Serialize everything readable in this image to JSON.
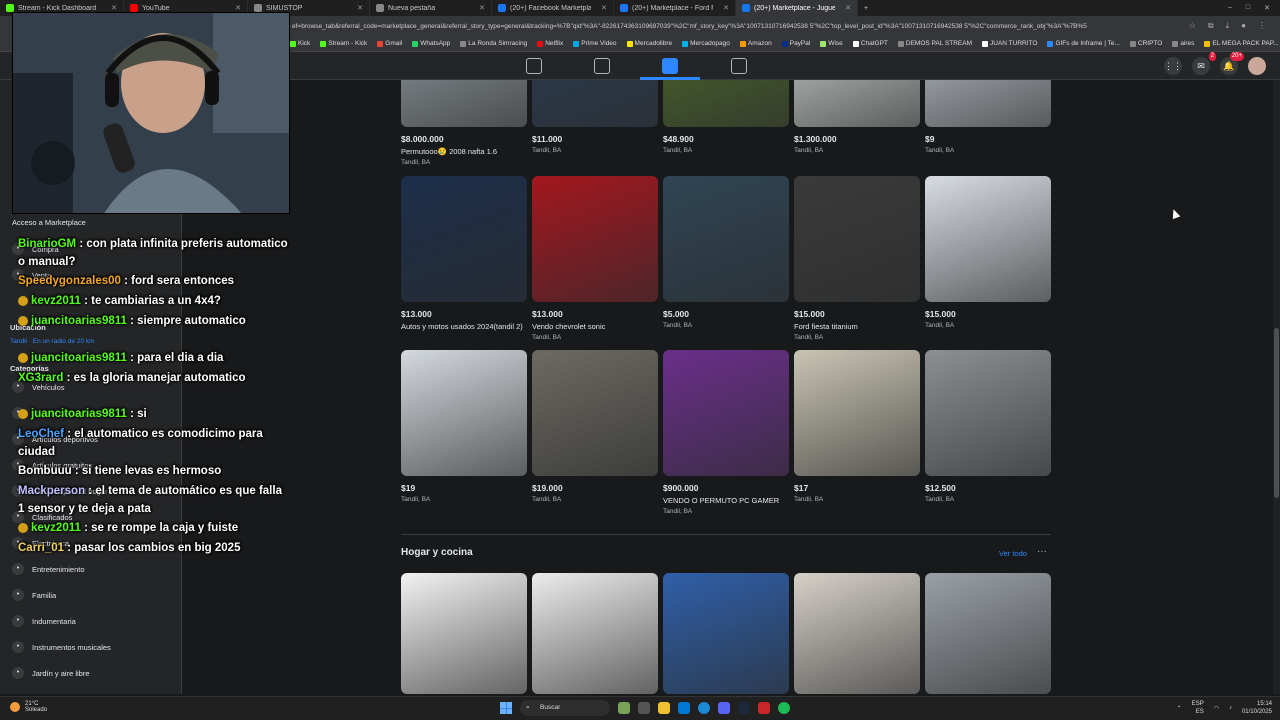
{
  "browser": {
    "tabs": [
      {
        "label": "Stream - Kick Dashboard",
        "color": "#53fc18"
      },
      {
        "label": "YouTube",
        "color": "#ff0000"
      },
      {
        "label": "SIMUSTOP",
        "color": "#888888"
      },
      {
        "label": "Nueva pestaña",
        "color": "#888888"
      },
      {
        "label": "(20+) Facebook Marketplace | Fa...",
        "color": "#1877f2"
      },
      {
        "label": "(20+) Marketplace - Ford Focus",
        "color": "#1877f2"
      },
      {
        "label": "(20+) Marketplace - Juguetes tu...",
        "color": "#1877f2"
      }
    ],
    "url": "ef=browse_tab&referral_code=marketplace_general&referral_story_type=general&tracking=%7B\"qid\"%3A\"-8226174363109697039\"%2C\"mf_story_key\"%3A\"10071310716942538 5\"%2C\"top_level_post_id\"%3A\"10071310716942538 5\"%2C\"commerce_rank_obj\"%3A\"%7B%5",
    "bookmarks": [
      {
        "label": "Kick",
        "color": "#53fc18"
      },
      {
        "label": "Stream - Kick",
        "color": "#53fc18"
      },
      {
        "label": "Gmail",
        "color": "#ea4335"
      },
      {
        "label": "WhatsApp",
        "color": "#25d366"
      },
      {
        "label": "La Ronda Simracing",
        "color": "#888888"
      },
      {
        "label": "Netflix",
        "color": "#e50914"
      },
      {
        "label": "Prime Video",
        "color": "#00a8e1"
      },
      {
        "label": "Mercadolibre",
        "color": "#ffe600"
      },
      {
        "label": "Mercadopago",
        "color": "#00b1ea"
      },
      {
        "label": "Amazon",
        "color": "#ff9900"
      },
      {
        "label": "PayPal",
        "color": "#003087"
      },
      {
        "label": "Wise",
        "color": "#9fe870"
      },
      {
        "label": "ChatGPT",
        "color": "#ffffff"
      },
      {
        "label": "DEMOS PAL STREAM",
        "color": "#888888"
      },
      {
        "label": "JUAN TURRITO",
        "color": "#ffffff"
      },
      {
        "label": "GIFs de Inframe | Te...",
        "color": "#2d88ff"
      },
      {
        "label": "CRIPTO",
        "color": "#888888"
      },
      {
        "label": "aires",
        "color": "#888888"
      },
      {
        "label": "EL MEGA PACK PAP...",
        "color": "#f0c000"
      }
    ]
  },
  "fb_header": {
    "badges": {
      "messenger": "2",
      "notifications": "20+"
    }
  },
  "sidebar": {
    "top_link": "Acceso a Marketplace",
    "items_top": [
      {
        "label": "Compra",
        "icon": "shop-icon"
      },
      {
        "label": "Venta",
        "icon": "tag-icon"
      }
    ],
    "location_heading": "Ubicación",
    "location_value": "Tandil · En un radio de 20 km",
    "categories_heading": "Categorías",
    "categories": [
      {
        "label": "Vehículos",
        "icon": "car-icon"
      },
      {
        "label": "Alquiler de propiedades",
        "icon": "house-icon"
      },
      {
        "label": "Artículos deportivos",
        "icon": "sport-icon"
      },
      {
        "label": "Artículos gratuitos",
        "icon": "gift-icon"
      },
      {
        "label": "Artículos para el hogar",
        "icon": "home-icon"
      },
      {
        "label": "Clasificados",
        "icon": "list-icon"
      },
      {
        "label": "Electrónica",
        "icon": "phone-icon"
      },
      {
        "label": "Entretenimiento",
        "icon": "people-icon"
      },
      {
        "label": "Familia",
        "icon": "heart-icon"
      },
      {
        "label": "Indumentaria",
        "icon": "shirt-icon"
      },
      {
        "label": "Instrumentos musicales",
        "icon": "music-icon"
      },
      {
        "label": "Jardín y aire libre",
        "icon": "garden-icon"
      }
    ]
  },
  "chat": [
    {
      "user": "BinarioGM",
      "color": "#53fc18",
      "text": "con plata infinita preferis automatico o manual?",
      "badge": false
    },
    {
      "user": "Speedygonzales00",
      "color": "#f5a623",
      "text": "ford sera entonces",
      "badge": false
    },
    {
      "user": "kevz2011",
      "color": "#53fc18",
      "text": "te cambiarias a un 4x4?",
      "badge": true
    },
    {
      "user": "juancitoarias9811",
      "color": "#53fc18",
      "text": "siempre automatico",
      "badge": true
    },
    {
      "user": "juancitoarias9811",
      "color": "#53fc18",
      "text": "para el dia a dia",
      "badge": true
    },
    {
      "user": "XG3rard",
      "color": "#53fc18",
      "text": "es la gloria manejar automatico",
      "badge": false
    },
    {
      "user": "juancitoarias9811",
      "color": "#53fc18",
      "text": "si",
      "badge": true
    },
    {
      "user": "LeoChef",
      "color": "#4aa3ff",
      "text": "el automatico es comodicimo para ciudad",
      "badge": false
    },
    {
      "user": "Bombuuu",
      "color": "#ffffff",
      "text": "si tiene levas es hermoso",
      "badge": false
    },
    {
      "user": "Mackperson",
      "color": "#c0c0ff",
      "text": "el tema de automático es que falla 1 sensor y te deja a pata",
      "badge": false
    },
    {
      "user": "kevz2011",
      "color": "#53fc18",
      "text": "se re rompe la caja y fuiste",
      "badge": true
    },
    {
      "user": "Carri_01",
      "color": "#f0d060",
      "text": "pasar los cambios en big 2025",
      "badge": false
    }
  ],
  "listings_row1": [
    {
      "price": "$8.000.000",
      "title": "Permutooo😢 2008 nafta 1.6",
      "loc": "Tandil, BA",
      "bg": "#9aa3a8"
    },
    {
      "price": "$11.000",
      "title": "",
      "loc": "Tandil, BA",
      "bg": "#2c3e55"
    },
    {
      "price": "$48.900",
      "title": "",
      "loc": "Tandil, BA",
      "bg": "#4f6b2c"
    },
    {
      "price": "$1.300.000",
      "title": "",
      "loc": "Tandil, BA",
      "bg": "#d9dcdc"
    },
    {
      "price": "$9",
      "title": "",
      "loc": "Tandil, BA",
      "bg": "#c8cfd6"
    }
  ],
  "listings_row2": [
    {
      "price": "$13.000",
      "title": "Autos y motos usados 2024(tandil 2)",
      "loc": "",
      "bg": "#1c2e4a"
    },
    {
      "price": "$13.000",
      "title": "Vendo chevrolet sonic",
      "loc": "Tandil, BA",
      "bg": "#a3171f"
    },
    {
      "price": "$5.000",
      "title": "",
      "loc": "Tandil, BA",
      "bg": "#2f4555"
    },
    {
      "price": "$15.000",
      "title": "Ford fiesta titanium",
      "loc": "Tandil, BA",
      "bg": "#3a3a3a"
    },
    {
      "price": "$15.000",
      "title": "",
      "loc": "Tandil, BA",
      "bg": "#d8dde3"
    }
  ],
  "listings_row3": [
    {
      "price": "$19",
      "title": "",
      "loc": "Tandil, BA",
      "bg": "#d4d9de"
    },
    {
      "price": "$19.000",
      "title": "",
      "loc": "Tandil, BA",
      "bg": "#6d6a62"
    },
    {
      "price": "$900.000",
      "title": "VENDO O PERMUTO PC GAMER",
      "loc": "Tandil, BA",
      "bg": "#6a2f8a"
    },
    {
      "price": "$17",
      "title": "",
      "loc": "Tandil, BA",
      "bg": "#c9c4b3"
    },
    {
      "price": "$12.500",
      "title": "",
      "loc": "Tandil, BA",
      "bg": "#8c8f93"
    }
  ],
  "section": {
    "title": "Hogar y cocina",
    "see_all": "Ver todo",
    "more": "···"
  },
  "listings_row4": [
    {
      "bg": "#f2f2f2"
    },
    {
      "bg": "#ececec"
    },
    {
      "bg": "#2f5fa8"
    },
    {
      "bg": "#d6d0c8"
    },
    {
      "bg": "#9aa0a6"
    }
  ],
  "taskbar": {
    "temp": "21°C",
    "weather": "Soleado",
    "search": "Buscar",
    "lang1": "ESP",
    "lang2": "ES",
    "time": "15:14",
    "date": "01/10/2025"
  }
}
